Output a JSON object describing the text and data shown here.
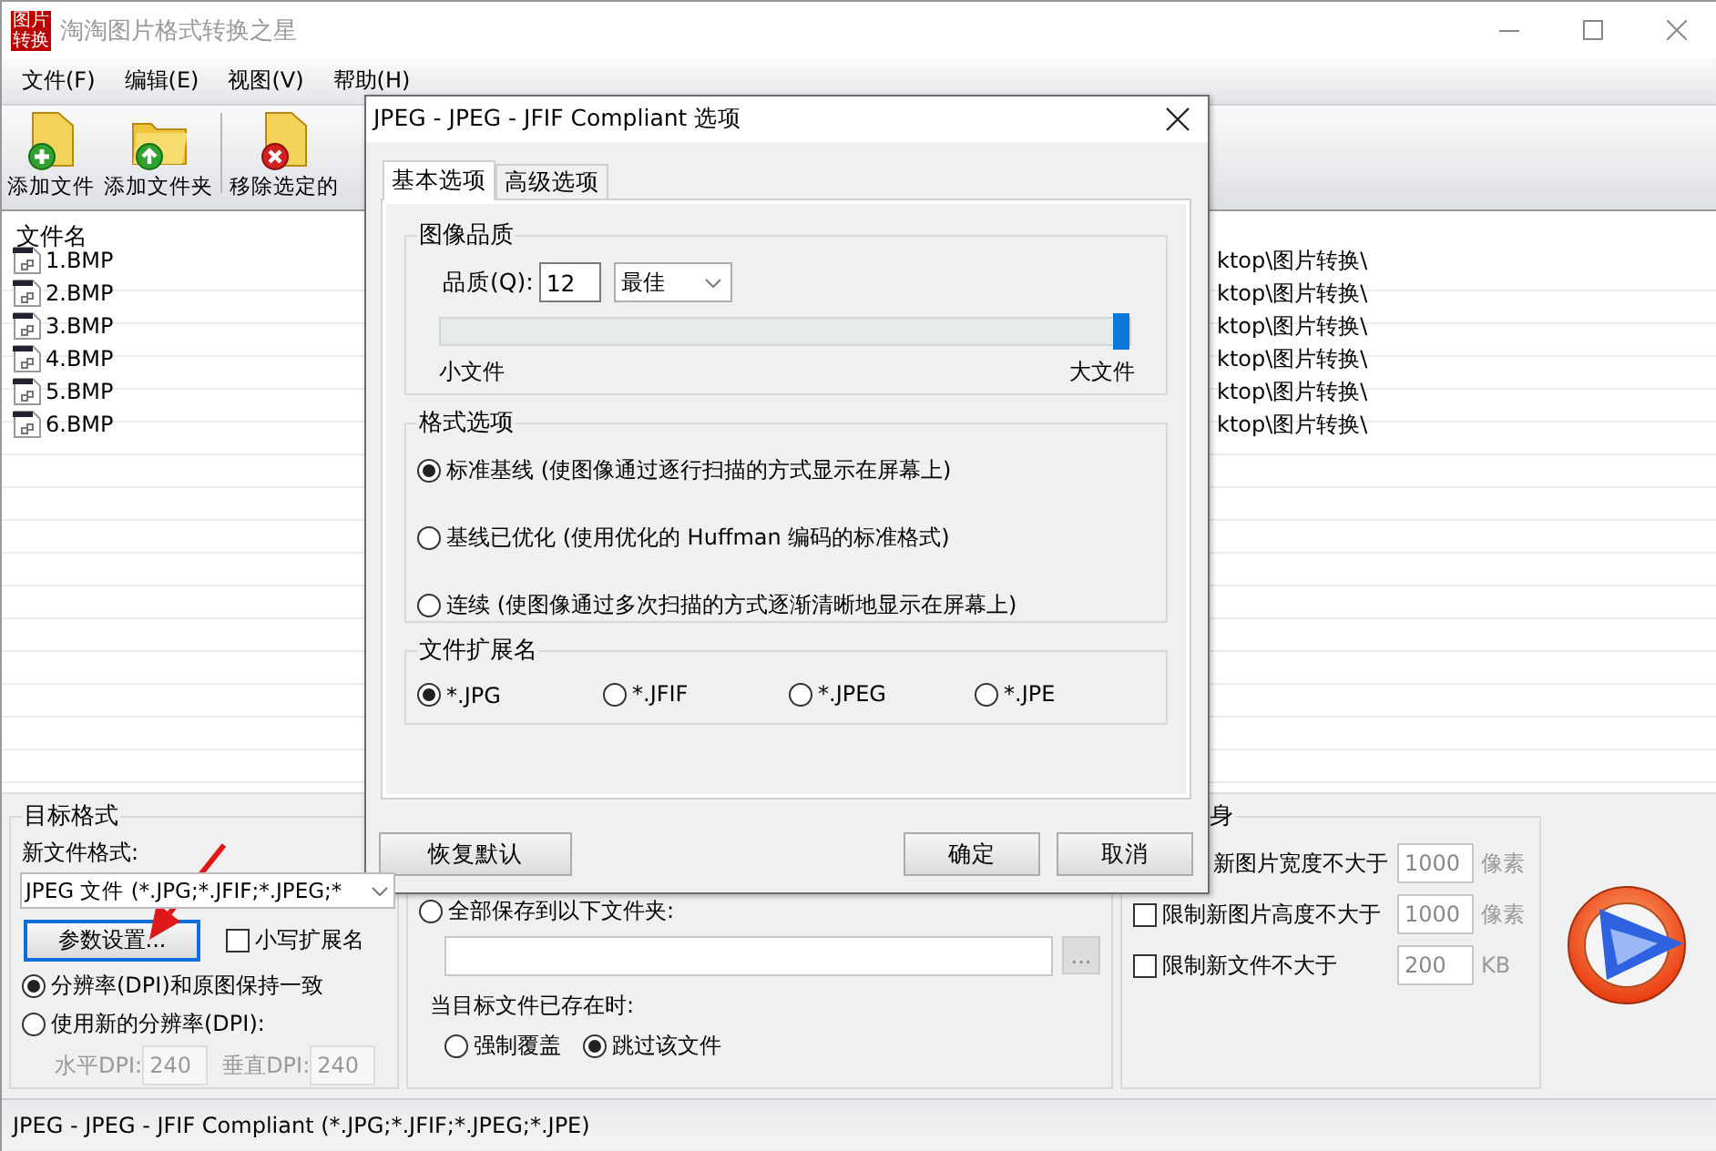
{
  "window": {
    "logo_text": "图片转换",
    "title": "淘淘图片格式转换之星"
  },
  "menu": [
    "文件(F)",
    "编辑(E)",
    "视图(V)",
    "帮助(H)"
  ],
  "toolbar": [
    {
      "kind": "add-file",
      "label": "添加文件"
    },
    {
      "kind": "add-folder",
      "label": "添加文件夹"
    },
    {
      "kind": "remove",
      "label": "移除选定的"
    }
  ],
  "file_list": {
    "columns": [
      "文件名"
    ],
    "rows": [
      {
        "name": "1.BMP",
        "column_2": "ktop\\图片转换\\"
      },
      {
        "name": "2.BMP",
        "column_2": "ktop\\图片转换\\"
      },
      {
        "name": "3.BMP",
        "column_2": "ktop\\图片转换\\"
      },
      {
        "name": "4.BMP",
        "column_2": "ktop\\图片转换\\"
      },
      {
        "name": "5.BMP",
        "column_2": "ktop\\图片转换\\"
      },
      {
        "name": "6.BMP",
        "column_2": "ktop\\图片转换\\"
      }
    ]
  },
  "target_format": {
    "title": "目标格式",
    "format_label": "新文件格式:",
    "format_value": "JPEG 文件 (*.JPG;*.JFIF;*.JPEG;*",
    "settings_button": "参数设置...",
    "lowercase": {
      "label": "小写扩展名",
      "checked": false
    },
    "dpi_options": [
      {
        "label": "分辨率(DPI)和原图保持一致",
        "selected": true
      },
      {
        "label": "使用新的分辨率(DPI):",
        "selected": false
      }
    ],
    "dpi_fields": [
      {
        "label": "水平DPI:",
        "value": "240",
        "disabled": true
      },
      {
        "label": "垂直DPI:",
        "value": "240",
        "disabled": true
      }
    ]
  },
  "output": {
    "save_all": {
      "label": "全部保存到以下文件夹:",
      "selected": false
    },
    "browse_button": "...",
    "exists_label": "当目标文件已存在时:",
    "exists_options": [
      {
        "label": "强制覆盖",
        "selected": false
      },
      {
        "label": "跳过该文件",
        "selected": true
      }
    ]
  },
  "resize": {
    "title": "身",
    "limits": [
      {
        "label": "新图片宽度不大于",
        "value": "1000",
        "unit": "像素"
      },
      {
        "label": "限制新图片高度不大于",
        "checked": false,
        "value": "1000",
        "unit": "像素"
      },
      {
        "label": "限制新文件不大于",
        "checked": false,
        "value": "200",
        "unit": "KB"
      }
    ]
  },
  "status_bar": "JPEG - JPEG - JFIF Compliant (*.JPG;*.JFIF;*.JPEG;*.JPE)",
  "dialog": {
    "title": "JPEG - JPEG - JFIF Compliant 选项",
    "tabs": [
      {
        "label": "基本选项",
        "selected": true
      },
      {
        "label": "高级选项",
        "selected": false
      }
    ],
    "quality_group": {
      "title": "图像品质",
      "label": "品质(Q):",
      "value": "12",
      "preset": "最佳",
      "level": 1,
      "min_label": "小文件",
      "max_label": "大文件"
    },
    "format_group": {
      "title": "格式选项",
      "options": [
        {
          "label": "标准基线 (使图像通过逐行扫描的方式显示在屏幕上)",
          "selected": true
        },
        {
          "label": "基线已优化 (使用优化的 Huffman 编码的标准格式)",
          "selected": false
        },
        {
          "label": "连续 (使图像通过多次扫描的方式逐渐清晰地显示在屏幕上)",
          "selected": false
        }
      ]
    },
    "extension_group": {
      "title": "文件扩展名",
      "options": [
        {
          "label": "*.JPG",
          "selected": true
        },
        {
          "label": "*.JFIF",
          "selected": false
        },
        {
          "label": "*.JPEG",
          "selected": false
        },
        {
          "label": "*.JPE",
          "selected": false
        }
      ]
    },
    "buttons": [
      {
        "kind": "reset",
        "label": "恢复默认"
      },
      {
        "kind": "ok",
        "label": "确定"
      },
      {
        "kind": "cancel",
        "label": "取消"
      }
    ]
  }
}
